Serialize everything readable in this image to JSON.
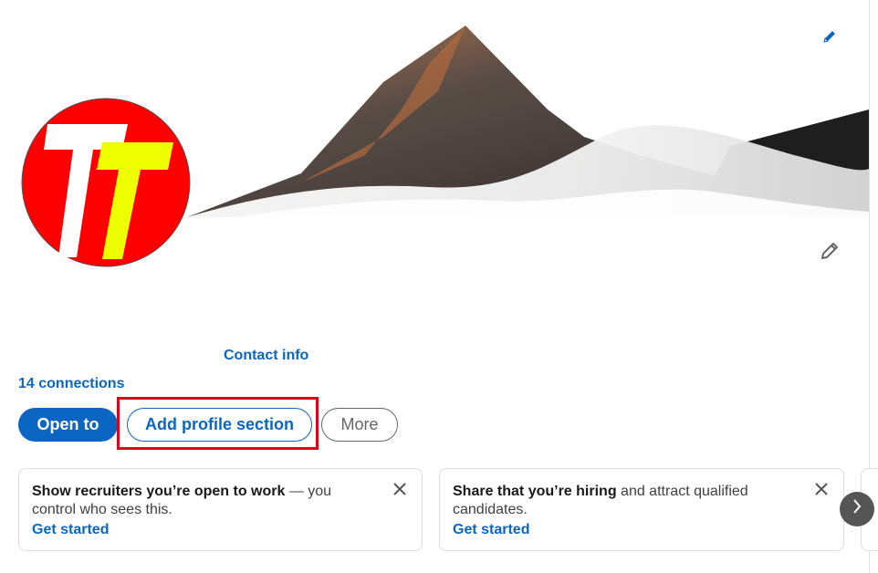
{
  "profile": {
    "contact_info_label": "Contact info",
    "connections_label": "14 connections",
    "avatar_letter": "T"
  },
  "actions": {
    "open_to_label": "Open to",
    "add_section_label": "Add profile section",
    "more_label": "More"
  },
  "recommendations": [
    {
      "bold": "Show recruiters you’re open to work",
      "rest": " — you control who sees this.",
      "cta": "Get started",
      "close_icon": "close-icon"
    },
    {
      "bold": "Share that you’re hiring",
      "rest": " and attract qualified candidates.",
      "cta": "Get started",
      "close_icon": "close-icon"
    }
  ],
  "icons": {
    "edit_banner": "pencil-icon",
    "edit_intro": "pencil-icon",
    "carousel_next": "chevron-right-icon"
  },
  "colors": {
    "brand_blue": "#0a66c2",
    "highlight_red": "#e0001b",
    "avatar_red": "#ff0000",
    "avatar_yellow": "#eeff00"
  }
}
